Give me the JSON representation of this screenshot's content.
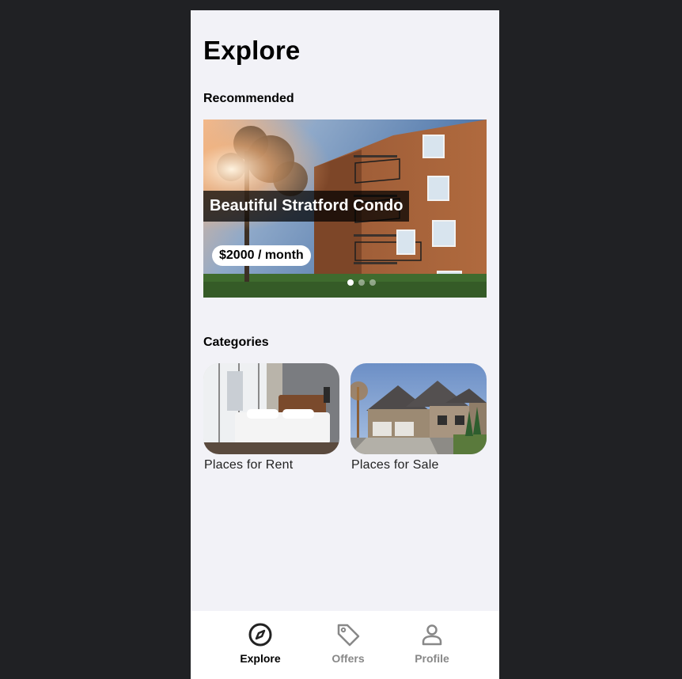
{
  "page": {
    "title": "Explore"
  },
  "recommended": {
    "heading": "Recommended",
    "featured": {
      "title": "Beautiful Stratford Condo",
      "price": "$2000 / month"
    },
    "carousel": {
      "slide_count": 3,
      "active_index": 0
    }
  },
  "categories": {
    "heading": "Categories",
    "items": [
      {
        "label": "Places for Rent",
        "image": "bedroom-photo"
      },
      {
        "label": "Places for Sale",
        "image": "house-photo"
      }
    ]
  },
  "tabbar": {
    "items": [
      {
        "label": "Explore",
        "icon": "compass-icon",
        "active": true
      },
      {
        "label": "Offers",
        "icon": "tag-icon",
        "active": false
      },
      {
        "label": "Profile",
        "icon": "user-icon",
        "active": false
      }
    ],
    "active_color": "#222222",
    "inactive_color": "#888888"
  }
}
